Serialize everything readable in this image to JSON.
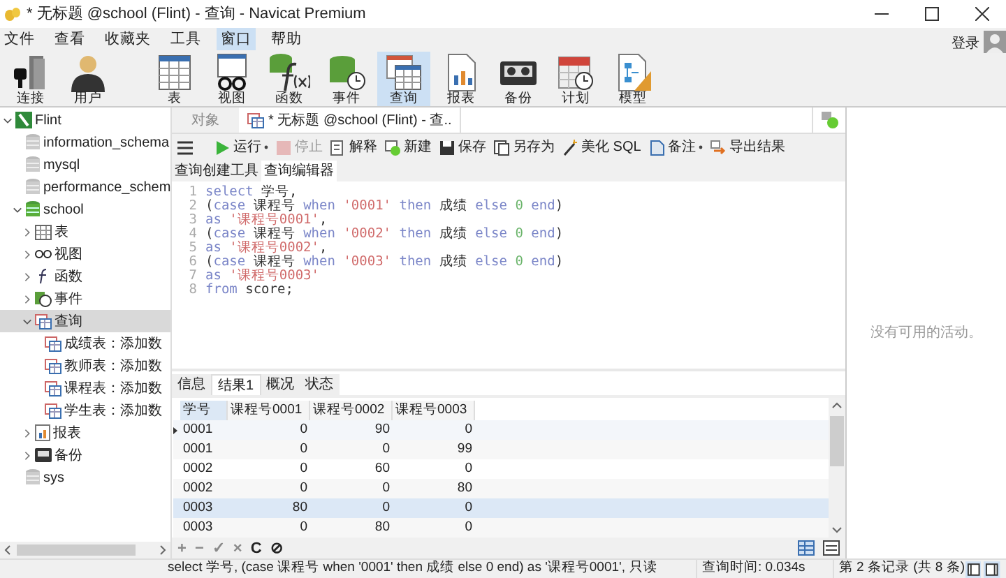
{
  "window": {
    "title": "* 无标题 @school (Flint) - 查询 - Navicat Premium"
  },
  "menu": [
    {
      "label": "文件",
      "selected": false
    },
    {
      "label": "查看",
      "selected": false
    },
    {
      "label": "收藏夹",
      "selected": false
    },
    {
      "label": "工具",
      "selected": false
    },
    {
      "label": "窗口",
      "selected": true
    },
    {
      "label": "帮助",
      "selected": false
    }
  ],
  "login": "登录",
  "toolbar": [
    {
      "kind": "connect",
      "label": "连接",
      "selected": false
    },
    {
      "kind": "user",
      "label": "用户",
      "selected": false
    },
    {
      "kind": "table",
      "label": "表",
      "selected": false
    },
    {
      "kind": "view",
      "label": "视图",
      "selected": false
    },
    {
      "kind": "function",
      "label": "函数",
      "selected": false
    },
    {
      "kind": "event",
      "label": "事件",
      "selected": false
    },
    {
      "kind": "query",
      "label": "查询",
      "selected": true
    },
    {
      "kind": "report",
      "label": "报表",
      "selected": false
    },
    {
      "kind": "backup",
      "label": "备份",
      "selected": false
    },
    {
      "kind": "schedule",
      "label": "计划",
      "selected": false
    },
    {
      "kind": "model",
      "label": "模型",
      "selected": false
    }
  ],
  "sidebar": {
    "items": [
      {
        "kind": "connection",
        "label": "Flint",
        "expanded": true,
        "selected": false,
        "children": [
          {
            "kind": "db",
            "label": "information_schema",
            "selected": false
          },
          {
            "kind": "db",
            "label": "mysql",
            "selected": false
          },
          {
            "kind": "db",
            "label": "performance_schem",
            "selected": false
          },
          {
            "kind": "db-open",
            "label": "school",
            "expanded": true,
            "selected": false,
            "children": [
              {
                "kind": "table",
                "label": "表",
                "expanded": false,
                "selected": false
              },
              {
                "kind": "view",
                "label": "视图",
                "expanded": false,
                "selected": false
              },
              {
                "kind": "function",
                "label": "函数",
                "expanded": false,
                "selected": false
              },
              {
                "kind": "event",
                "label": "事件",
                "expanded": false,
                "selected": false
              },
              {
                "kind": "query",
                "label": "查询",
                "expanded": true,
                "selected": true,
                "children": [
                  {
                    "kind": "query",
                    "label": "成绩表：添加数",
                    "selected": false
                  },
                  {
                    "kind": "query",
                    "label": "教师表：添加数",
                    "selected": false
                  },
                  {
                    "kind": "query",
                    "label": "课程表：添加数",
                    "selected": false
                  },
                  {
                    "kind": "query",
                    "label": "学生表：添加数",
                    "selected": false
                  }
                ]
              },
              {
                "kind": "report",
                "label": "报表",
                "expanded": false,
                "selected": false
              },
              {
                "kind": "backup",
                "label": "备份",
                "expanded": false,
                "selected": false
              }
            ]
          },
          {
            "kind": "db",
            "label": "sys",
            "selected": false
          }
        ]
      }
    ]
  },
  "doc_tabs": [
    {
      "label": "对象",
      "selected": false
    },
    {
      "label": "* 无标题 @school (Flint) - 查..",
      "selected": true
    }
  ],
  "query_toolbar": [
    {
      "kind": "run",
      "label": "运行",
      "dropdown": true,
      "disabled": false
    },
    {
      "kind": "stop",
      "label": "停止",
      "dropdown": false,
      "disabled": true
    },
    {
      "kind": "explain",
      "label": "解释",
      "dropdown": false,
      "disabled": false
    },
    {
      "kind": "new",
      "label": "新建",
      "dropdown": false,
      "disabled": false
    },
    {
      "kind": "save",
      "label": "保存",
      "dropdown": false,
      "disabled": false
    },
    {
      "kind": "saveas",
      "label": "另存为",
      "dropdown": false,
      "disabled": false
    },
    {
      "kind": "beautify",
      "label": "美化 SQL",
      "dropdown": false,
      "disabled": false
    },
    {
      "kind": "note",
      "label": "备注",
      "dropdown": true,
      "disabled": false
    },
    {
      "kind": "export",
      "label": "导出结果",
      "dropdown": false,
      "disabled": false
    }
  ],
  "editor_tabs": [
    {
      "label": "查询创建工具",
      "selected": false
    },
    {
      "label": "查询编辑器",
      "selected": true
    }
  ],
  "editor": {
    "lines": [
      {
        "number": "1",
        "tokens": [
          {
            "kind": "kw",
            "text": "select"
          },
          {
            "kind": "plain",
            "text": " 学号,"
          }
        ]
      },
      {
        "number": "2",
        "tokens": [
          {
            "kind": "plain",
            "text": "("
          },
          {
            "kind": "kw",
            "text": "case"
          },
          {
            "kind": "plain",
            "text": " 课程号 "
          },
          {
            "kind": "kw",
            "text": "when "
          },
          {
            "kind": "str",
            "text": "'0001' "
          },
          {
            "kind": "kw",
            "text": "then"
          },
          {
            "kind": "plain",
            "text": " 成绩 "
          },
          {
            "kind": "kw",
            "text": "else "
          },
          {
            "kind": "num",
            "text": "0 "
          },
          {
            "kind": "kw",
            "text": "end"
          },
          {
            "kind": "plain",
            "text": ")"
          }
        ]
      },
      {
        "number": "3",
        "tokens": [
          {
            "kind": "kw",
            "text": "as "
          },
          {
            "kind": "str",
            "text": "'课程号0001'"
          },
          {
            "kind": "plain",
            "text": ","
          }
        ]
      },
      {
        "number": "4",
        "tokens": [
          {
            "kind": "plain",
            "text": "("
          },
          {
            "kind": "kw",
            "text": "case"
          },
          {
            "kind": "plain",
            "text": " 课程号 "
          },
          {
            "kind": "kw",
            "text": "when "
          },
          {
            "kind": "str",
            "text": "'0002' "
          },
          {
            "kind": "kw",
            "text": "then"
          },
          {
            "kind": "plain",
            "text": " 成绩 "
          },
          {
            "kind": "kw",
            "text": "else "
          },
          {
            "kind": "num",
            "text": "0 "
          },
          {
            "kind": "kw",
            "text": "end"
          },
          {
            "kind": "plain",
            "text": ")"
          }
        ]
      },
      {
        "number": "5",
        "tokens": [
          {
            "kind": "kw",
            "text": "as "
          },
          {
            "kind": "str",
            "text": "'课程号0002'"
          },
          {
            "kind": "plain",
            "text": ","
          }
        ]
      },
      {
        "number": "6",
        "tokens": [
          {
            "kind": "plain",
            "text": "("
          },
          {
            "kind": "kw",
            "text": "case"
          },
          {
            "kind": "plain",
            "text": " 课程号 "
          },
          {
            "kind": "kw",
            "text": "when "
          },
          {
            "kind": "str",
            "text": "'0003' "
          },
          {
            "kind": "kw",
            "text": "then"
          },
          {
            "kind": "plain",
            "text": " 成绩 "
          },
          {
            "kind": "kw",
            "text": "else "
          },
          {
            "kind": "num",
            "text": "0 "
          },
          {
            "kind": "kw",
            "text": "end"
          },
          {
            "kind": "plain",
            "text": ")"
          }
        ]
      },
      {
        "number": "7",
        "tokens": [
          {
            "kind": "kw",
            "text": "as "
          },
          {
            "kind": "str",
            "text": "'课程号0003'"
          }
        ]
      },
      {
        "number": "8",
        "tokens": [
          {
            "kind": "kw",
            "text": "from"
          },
          {
            "kind": "plain",
            "text": " score;"
          }
        ]
      }
    ]
  },
  "result_tabs": [
    {
      "label": "信息",
      "selected": false
    },
    {
      "label": "结果1",
      "selected": true
    },
    {
      "label": "概况",
      "selected": false
    },
    {
      "label": "状态",
      "selected": false
    }
  ],
  "table": {
    "columns": [
      "学号",
      "课程号0001",
      "课程号0002",
      "课程号0003"
    ],
    "rows": [
      {
        "cells": [
          "0001",
          "0",
          "90",
          "0"
        ],
        "current": true,
        "highlighted": false
      },
      {
        "cells": [
          "0001",
          "0",
          "0",
          "99"
        ],
        "current": false,
        "highlighted": false
      },
      {
        "cells": [
          "0002",
          "0",
          "60",
          "0"
        ],
        "current": false,
        "highlighted": false
      },
      {
        "cells": [
          "0002",
          "0",
          "0",
          "80"
        ],
        "current": false,
        "highlighted": false
      },
      {
        "cells": [
          "0003",
          "80",
          "0",
          "0"
        ],
        "current": false,
        "highlighted": true
      },
      {
        "cells": [
          "0003",
          "0",
          "80",
          "0"
        ],
        "current": false,
        "highlighted": false
      }
    ]
  },
  "grid_toolbar": [
    {
      "label": "+",
      "disabled": true
    },
    {
      "label": "−",
      "disabled": true
    },
    {
      "label": "✓",
      "disabled": true
    },
    {
      "label": "×",
      "disabled": true
    },
    {
      "label": "C",
      "disabled": false
    },
    {
      "label": "⊘",
      "disabled": false
    }
  ],
  "activity": {
    "empty_text": "没有可用的活动。"
  },
  "status_bar": {
    "sql": "select 学号, (case 课程号 when '0001' then 成绩 else 0 end) as '课程号0001',",
    "mode": "只读",
    "query_time": "查询时间: 0.034s",
    "record": "第 2 条记录 (共 8 条)"
  }
}
